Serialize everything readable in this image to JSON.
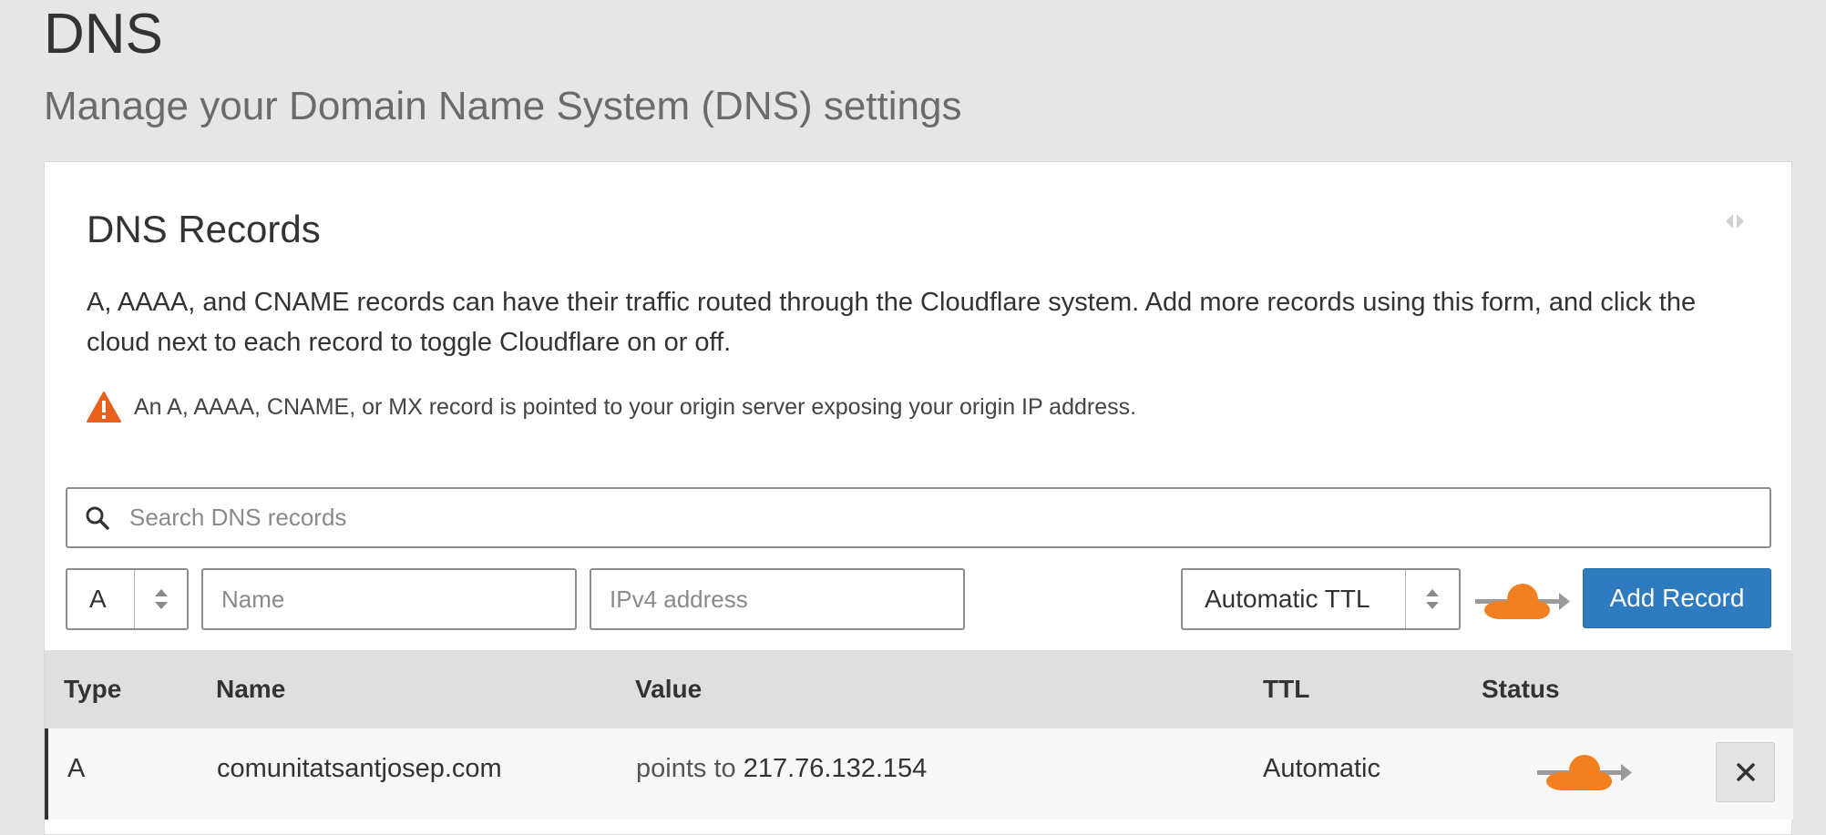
{
  "header": {
    "title": "DNS",
    "subtitle": "Manage your Domain Name System (DNS) settings"
  },
  "card": {
    "title": "DNS Records",
    "description": "A, AAAA, and CNAME records can have their traffic routed through the Cloudflare system. Add more records using this form, and click the cloud next to each record to toggle Cloudflare on or off.",
    "warning": "An A, AAAA, CNAME, or MX record is pointed to your origin server exposing your origin IP address.",
    "collapse_icon": "collapse-arrows-icon"
  },
  "search": {
    "placeholder": "Search DNS records",
    "icon": "search-icon"
  },
  "form": {
    "type_value": "A",
    "name_placeholder": "Name",
    "value_placeholder": "IPv4 address",
    "ttl_value": "Automatic TTL",
    "add_label": "Add Record"
  },
  "table": {
    "columns": [
      "Type",
      "Name",
      "Value",
      "TTL",
      "Status"
    ],
    "rows": [
      {
        "type": "A",
        "name": "comunitatsantjosep.com",
        "value_prefix": "points to",
        "value": "217.76.132.154",
        "ttl": "Automatic",
        "status_icon": "proxied-cloud-icon"
      }
    ]
  },
  "colors": {
    "accent": "#2f7bbf",
    "cloud_orange": "#f38020",
    "warning_orange": "#e8601c"
  }
}
